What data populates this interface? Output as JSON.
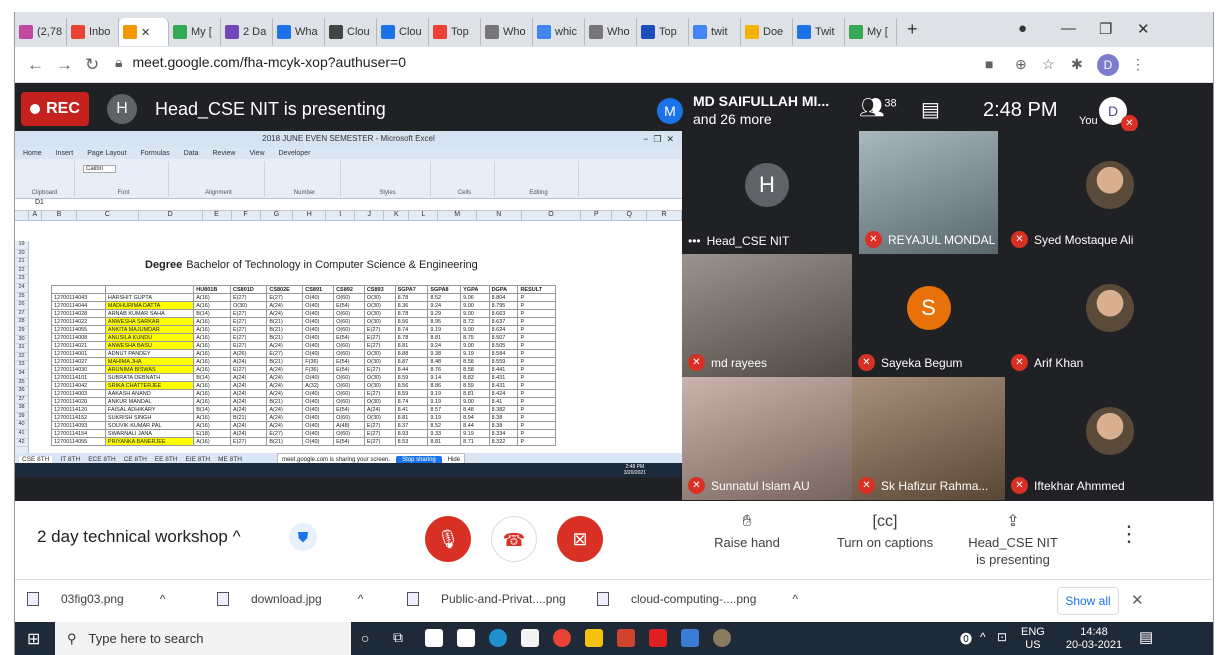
{
  "browser": {
    "tabs": [
      {
        "label": "(2,78",
        "color": "#c04aa0"
      },
      {
        "label": "Inbo",
        "color": "#ea4335"
      },
      {
        "label": "",
        "color": "#f29900",
        "active": true
      },
      {
        "label": "My [",
        "color": "#34a853"
      },
      {
        "label": "2 Da",
        "color": "#7248b9"
      },
      {
        "label": "Wha",
        "color": "#1a73e8"
      },
      {
        "label": "Clou",
        "color": "#444"
      },
      {
        "label": "Clou",
        "color": "#1a73e8"
      },
      {
        "label": "Top",
        "color": "#ea4335"
      },
      {
        "label": "Who",
        "color": "#777"
      },
      {
        "label": "whic",
        "color": "#4285f4"
      },
      {
        "label": "Who",
        "color": "#777"
      },
      {
        "label": "Top",
        "color": "#1a4fbb"
      },
      {
        "label": "twit",
        "color": "#4285f4"
      },
      {
        "label": "Doe",
        "color": "#f4b400"
      },
      {
        "label": "Twit",
        "color": "#1a73e8"
      },
      {
        "label": "My [",
        "color": "#34a853"
      }
    ],
    "new_tab": "+",
    "url": "meet.google.com/fha-mcyk-xop?authuser=0",
    "profile_initial": "D"
  },
  "meet": {
    "rec_label": "REC",
    "presenter_initial": "H",
    "presenting_title": "Head_CSE NIT is presenting",
    "meeting_avatar": "M",
    "meeting_owner": "MD SAIFULLAH MI...",
    "meeting_more": "and 26 more",
    "people_count": "38",
    "time": "2:48 PM",
    "you_label": "You",
    "you_initial": "D",
    "participants": [
      {
        "name": "Head_CSE NIT",
        "type": "initial",
        "initial": "H",
        "bg": "#5f6368",
        "prefix": "•••"
      },
      {
        "name": "REYAJUL MONDAL",
        "type": "video",
        "bg": "#8aa0a8"
      },
      {
        "name": "Syed Mostaque Ali",
        "type": "photo",
        "bg": "#202124"
      },
      {
        "name": "md rayees",
        "type": "video",
        "bg": "#7a6f68"
      },
      {
        "name": "Sayeka Begum",
        "type": "initial",
        "initial": "S",
        "bg": "#e8710a"
      },
      {
        "name": "Arif Khan",
        "type": "photo",
        "bg": "#202124"
      },
      {
        "name": "Sunnatul Islam AU",
        "type": "video",
        "bg": "#b89a90"
      },
      {
        "name": "Sk Hafizur Rahma...",
        "type": "video",
        "bg": "#8a6c52"
      },
      {
        "name": "Iftekhar Ahmmed",
        "type": "photo",
        "bg": "#202124"
      }
    ],
    "meeting_name": "2 day technical workshop",
    "actions": {
      "raise_hand": "Raise hand",
      "captions": "Turn on captions",
      "presenting_1": "Head_CSE NIT",
      "presenting_2": "is presenting"
    }
  },
  "excel": {
    "title": "2018 JUNE EVEN SEMESTER - Microsoft Excel",
    "ribbon_tabs": [
      "Home",
      "Insert",
      "Page Layout",
      "Formulas",
      "Data",
      "Review",
      "View",
      "Developer"
    ],
    "ribbon_groups": [
      "Clipboard",
      "Font",
      "Alignment",
      "Number",
      "Styles",
      "Cells",
      "Editing"
    ],
    "font_name": "Calibri",
    "cell_ref": "D1",
    "degree_label": "Degree",
    "degree_value": "Bachelor of Technology in Computer Science & Engineering",
    "headers": [
      "",
      "",
      "HU801B",
      "CS801D",
      "CS802E",
      "CS891",
      "CS892",
      "CS893",
      "SGPA7",
      "SGPA8",
      "YGPA",
      "DGPA",
      "RESULT"
    ],
    "rows": [
      [
        "12700114043",
        "HARSHIT GUPTA",
        "A(16)",
        "E(27)",
        "E(27)",
        "O(40)",
        "O(60)",
        "O(30)",
        "8.78",
        "8.52",
        "9.06",
        "8.804",
        "P"
      ],
      [
        "12700114044",
        "MADHURIMA DATTA",
        "A(16)",
        "O(30)",
        "A(24)",
        "O(40)",
        "E(54)",
        "O(30)",
        "8.36",
        "9.24",
        "9.00",
        "8.795",
        "P"
      ],
      [
        "12700114028",
        "ARNAB KUMAR SAHA",
        "B(14)",
        "E(27)",
        "A(24)",
        "O(40)",
        "O(60)",
        "O(30)",
        "8.78",
        "9.29",
        "9.00",
        "8.663",
        "P"
      ],
      [
        "12700114022",
        "ANWESHA SARKAR",
        "A(16)",
        "E(27)",
        "B(21)",
        "O(40)",
        "O(60)",
        "O(30)",
        "8.56",
        "8.95",
        "8.73",
        "8.637",
        "P"
      ],
      [
        "12700114055",
        "ANKITA MAJUMDAR",
        "A(16)",
        "E(27)",
        "B(21)",
        "O(40)",
        "O(60)",
        "E(27)",
        "8.74",
        "9.19",
        "9.00",
        "8.624",
        "P"
      ],
      [
        "12700114008",
        "ANUSILA KUNDU",
        "A(16)",
        "E(27)",
        "B(21)",
        "O(40)",
        "E(54)",
        "E(27)",
        "8.78",
        "8.81",
        "8.75",
        "8.507",
        "P"
      ],
      [
        "12700114021",
        "ANWESHA BASU",
        "A(16)",
        "E(27)",
        "A(24)",
        "O(40)",
        "O(60)",
        "E(27)",
        "8.81",
        "9.24",
        "9.00",
        "8.505",
        "P"
      ],
      [
        "12700114001",
        "ADNUT PANDEY",
        "A(16)",
        "A(26)",
        "E(27)",
        "O(40)",
        "O(60)",
        "O(30)",
        "8.88",
        "9.38",
        "9.19",
        "8.584",
        "P"
      ],
      [
        "12700114027",
        "MAHIMA JHA",
        "A(16)",
        "A(24)",
        "B(21)",
        "F(36)",
        "E(54)",
        "O(30)",
        "8.87",
        "8.48",
        "8.58",
        "8.559",
        "P"
      ],
      [
        "12700114030",
        "ARUNIMA BISWAS",
        "A(16)",
        "E(27)",
        "A(24)",
        "F(36)",
        "E(54)",
        "E(27)",
        "8.44",
        "8.76",
        "8.58",
        "8.441",
        "P"
      ],
      [
        "12700114101",
        "SUBRATA DEBNATH",
        "B(14)",
        "A(24)",
        "A(24)",
        "O(40)",
        "O(60)",
        "O(30)",
        "8.59",
        "9.14",
        "8.83",
        "8.431",
        "P"
      ],
      [
        "12700114042",
        "SRIKA CHATTERJEE",
        "A(16)",
        "A(24)",
        "A(24)",
        "A(32)",
        "O(60)",
        "O(30)",
        "8.56",
        "8.86",
        "8.59",
        "8.431",
        "P"
      ],
      [
        "12700114003",
        "AAKASH ANAND",
        "A(16)",
        "A(24)",
        "A(24)",
        "O(40)",
        "O(60)",
        "E(27)",
        "8.59",
        "9.19",
        "8.81",
        "8.424",
        "P"
      ],
      [
        "12700114020",
        "ANKUR MANDAL",
        "A(16)",
        "A(24)",
        "B(21)",
        "O(40)",
        "O(60)",
        "O(30)",
        "8.74",
        "9.19",
        "9.00",
        "8.41",
        "P"
      ],
      [
        "12700114120",
        "FAISAL ADHIKARY",
        "B(14)",
        "A(24)",
        "A(24)",
        "O(40)",
        "E(54)",
        "A(24)",
        "8.41",
        "8.57",
        "8.48",
        "8.382",
        "P"
      ],
      [
        "12700114152",
        "SUKRISH SINGH",
        "A(16)",
        "B(21)",
        "A(24)",
        "O(40)",
        "O(60)",
        "O(30)",
        "8.81",
        "9.19",
        "8.94",
        "8.38",
        "P"
      ],
      [
        "12700114093",
        "SOUVIK KUMAR PAL",
        "A(16)",
        "A(24)",
        "A(24)",
        "O(40)",
        "A(48)",
        "E(27)",
        "8.37",
        "8.52",
        "8.44",
        "8.38",
        "P"
      ],
      [
        "12700114154",
        "SWARNALI JANA",
        "E(18)",
        "A(24)",
        "E(27)",
        "O(40)",
        "O(60)",
        "E(27)",
        "8.93",
        "9.33",
        "9.19",
        "8.334",
        "P"
      ],
      [
        "12700114055",
        "PRIYANKA BANERJEE",
        "A(16)",
        "E(27)",
        "B(21)",
        "O(40)",
        "E(54)",
        "E(27)",
        "8.53",
        "8.81",
        "8.71",
        "8.322",
        "P"
      ]
    ],
    "highlighted_rows": [
      1,
      3,
      4,
      5,
      6,
      8,
      9,
      11,
      18
    ],
    "sheet_tabs": [
      "CSE 8TH",
      "IT 8TH",
      "ECE 8TH",
      "CE 8TH",
      "EE 8TH",
      "EIE 8TH",
      "ME 8TH"
    ],
    "sharing_text": "meet.google.com is sharing your screen.",
    "stop_sharing": "Stop sharing",
    "hide": "Hide",
    "taskbar_time": "2:48 PM",
    "taskbar_date": "3/20/2021",
    "row_numbers": [
      "19",
      "20",
      "21",
      "22",
      "23",
      "24",
      "25",
      "26",
      "27",
      "28",
      "29",
      "30",
      "31",
      "32",
      "33",
      "34",
      "35",
      "36",
      "37",
      "38",
      "39",
      "40",
      "41",
      "42"
    ],
    "columns": [
      "A",
      "B",
      "C",
      "D",
      "E",
      "F",
      "G",
      "H",
      "I",
      "J",
      "K",
      "L",
      "M",
      "N",
      "O",
      "P",
      "Q",
      "R"
    ]
  },
  "downloads": [
    {
      "name": "03fig03.png"
    },
    {
      "name": "download.jpg"
    },
    {
      "name": "Public-and-Privat....png"
    },
    {
      "name": "cloud-computing-....png"
    }
  ],
  "show_all": "Show all",
  "taskbar": {
    "search_placeholder": "Type here to search",
    "lang": "ENG",
    "region": "US",
    "time": "14:48",
    "date": "20-03-2021"
  }
}
